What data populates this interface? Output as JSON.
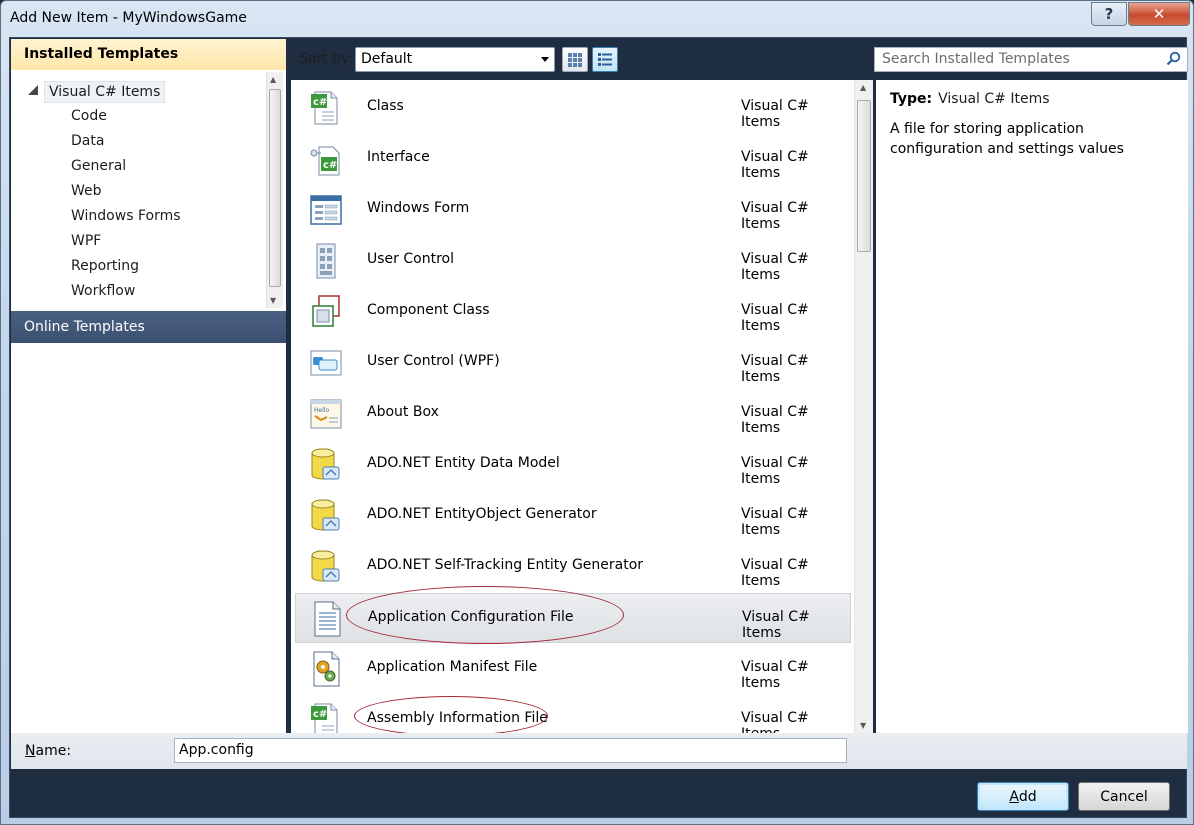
{
  "window": {
    "title": "Add New Item - MyWindowsGame",
    "help_glyph": "?",
    "close_glyph": "✕"
  },
  "left": {
    "installed_header": "Installed Templates",
    "tree_root": "Visual C# Items",
    "tree_items": [
      "Code",
      "Data",
      "General",
      "Web",
      "Windows Forms",
      "WPF",
      "Reporting",
      "Workflow"
    ],
    "online_header": "Online Templates"
  },
  "toolbar": {
    "sort_label": "Sort by:",
    "sort_value": "Default",
    "search_placeholder": "Search Installed Templates"
  },
  "templates": [
    {
      "name": "Class",
      "category": "Visual C# Items",
      "icon": "csharp-class-icon"
    },
    {
      "name": "Interface",
      "category": "Visual C# Items",
      "icon": "interface-icon"
    },
    {
      "name": "Windows Form",
      "category": "Visual C# Items",
      "icon": "windows-form-icon"
    },
    {
      "name": "User Control",
      "category": "Visual C# Items",
      "icon": "user-control-icon"
    },
    {
      "name": "Component Class",
      "category": "Visual C# Items",
      "icon": "component-class-icon"
    },
    {
      "name": "User Control (WPF)",
      "category": "Visual C# Items",
      "icon": "wpf-user-control-icon"
    },
    {
      "name": "About Box",
      "category": "Visual C# Items",
      "icon": "about-box-icon"
    },
    {
      "name": "ADO.NET Entity Data Model",
      "category": "Visual C# Items",
      "icon": "database-icon"
    },
    {
      "name": "ADO.NET EntityObject Generator",
      "category": "Visual C# Items",
      "icon": "database-icon"
    },
    {
      "name": "ADO.NET Self-Tracking Entity Generator",
      "category": "Visual C# Items",
      "icon": "database-icon"
    },
    {
      "name": "Application Configuration File",
      "category": "Visual C# Items",
      "icon": "config-file-icon",
      "selected": true
    },
    {
      "name": "Application Manifest File",
      "category": "Visual C# Items",
      "icon": "manifest-file-icon"
    },
    {
      "name": "Assembly Information File",
      "category": "Visual C# Items",
      "icon": "csharp-file-icon"
    }
  ],
  "details": {
    "type_label": "Type:",
    "type_value": "Visual C# Items",
    "description": "A file for storing application configuration and settings values"
  },
  "name_field": {
    "label_prefix": "N",
    "label_rest": "ame:",
    "value": "App.config"
  },
  "buttons": {
    "add_prefix": "A",
    "add_rest": "dd",
    "cancel": "Cancel"
  },
  "colors": {
    "selection_mark": "#a52a3a",
    "online_header_bg": "#3b5070",
    "installed_header_bg": "#fde7a9"
  }
}
